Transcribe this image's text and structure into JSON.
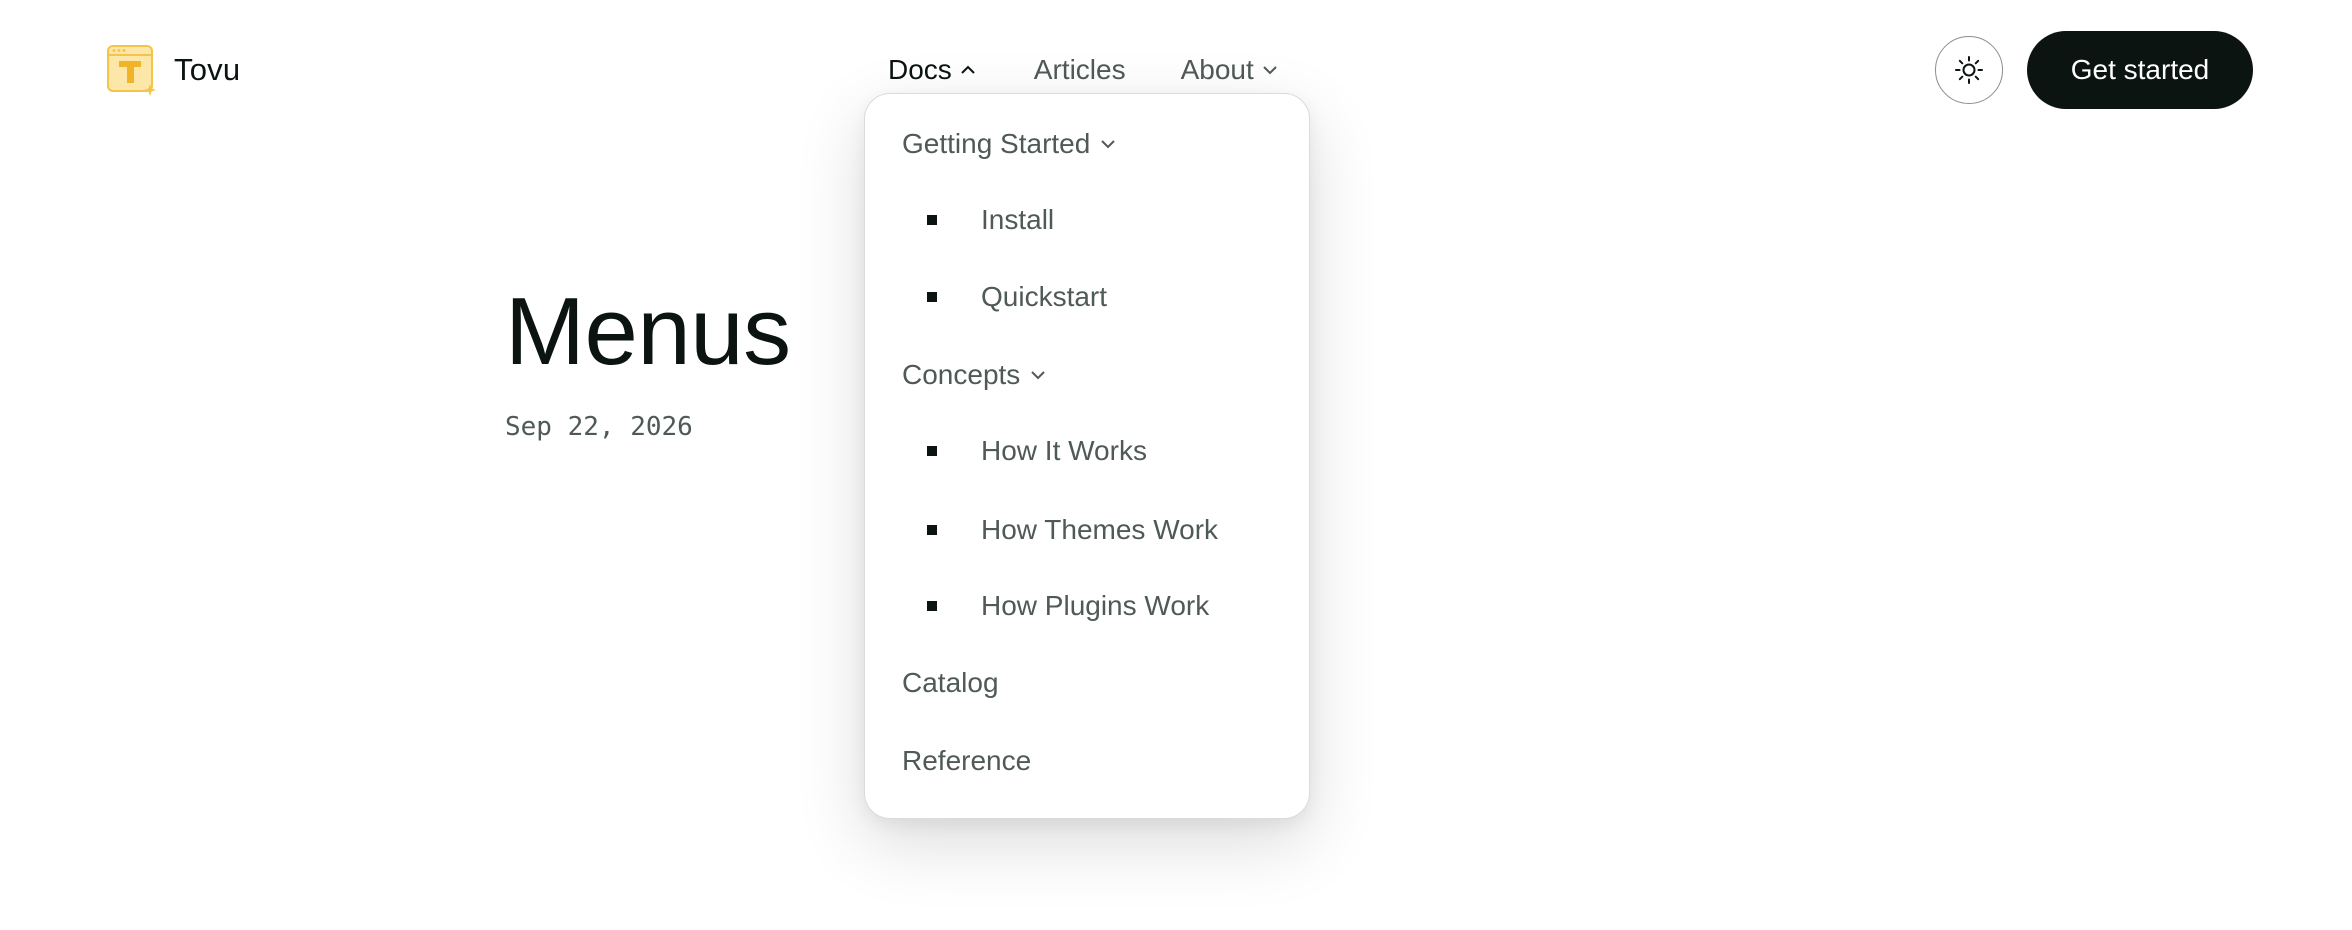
{
  "brand": {
    "name": "Tovu",
    "logo_icon": "tovu-logo-icon",
    "logo_letter": "T"
  },
  "nav": {
    "items": [
      {
        "label": "Docs",
        "icon": "chevron-up-icon",
        "expanded": true
      },
      {
        "label": "Articles"
      },
      {
        "label": "About",
        "icon": "chevron-down-icon",
        "expanded": false
      }
    ]
  },
  "header": {
    "theme_toggle_icon": "sun-icon",
    "cta_label": "Get started"
  },
  "dropdown": {
    "items": [
      {
        "label": "Getting Started",
        "type": "group",
        "icon": "chevron-down-icon"
      },
      {
        "label": "Install",
        "type": "child"
      },
      {
        "label": "Quickstart",
        "type": "child"
      },
      {
        "label": "Concepts",
        "type": "group",
        "icon": "chevron-down-icon"
      },
      {
        "label": "How It Works",
        "type": "child"
      },
      {
        "label": "How Themes Work",
        "type": "child"
      },
      {
        "label": "How Plugins Work",
        "type": "child"
      },
      {
        "label": "Catalog",
        "type": "link"
      },
      {
        "label": "Reference",
        "type": "link"
      }
    ]
  },
  "main": {
    "title": "Menus",
    "date": "Sep 22, 2026"
  },
  "colors": {
    "text": "#0b1410",
    "muted": "#505a55",
    "cta_bg": "#0b1410",
    "logo_accent": "#f7c948"
  }
}
